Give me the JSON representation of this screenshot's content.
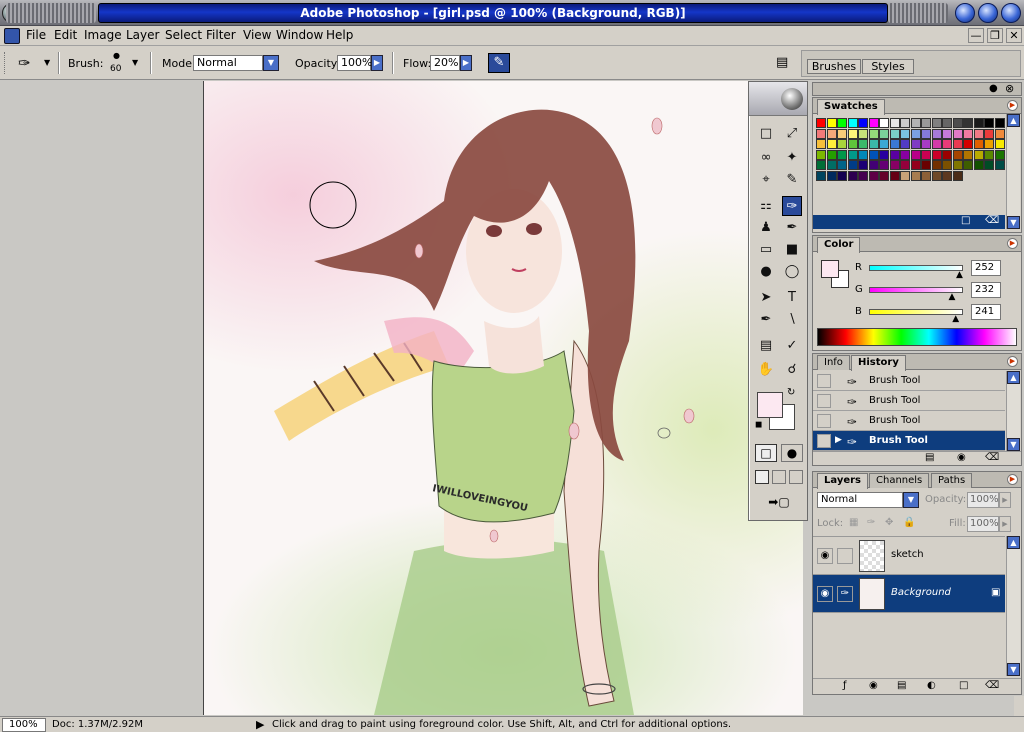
{
  "window": {
    "title": "Adobe Photoshop - [girl.psd @ 100% (Background, RGB)]"
  },
  "menu": [
    "File",
    "Edit",
    "Image",
    "Layer",
    "Select",
    "Filter",
    "View",
    "Window",
    "Help"
  ],
  "options": {
    "brush_label": "Brush:",
    "brush_size": "60",
    "mode_label": "Mode:",
    "mode_value": "Normal",
    "opacity_label": "Opacity:",
    "opacity_value": "100%",
    "flow_label": "Flow:",
    "flow_value": "20%"
  },
  "palette_well": {
    "tabs": [
      "Brushes",
      "Styles"
    ]
  },
  "canvas": {
    "shirt_text": "IWILLOVEINGYOU"
  },
  "swatches_panel": {
    "tab": "Swatches",
    "colors": [
      "#ff0000",
      "#ffff00",
      "#00ff00",
      "#00ffff",
      "#0000ff",
      "#ff00ff",
      "#ffffff",
      "#e6e6e6",
      "#cccccc",
      "#b3b3b3",
      "#999999",
      "#808080",
      "#666666",
      "#4d4d4d",
      "#333333",
      "#1a1a1a",
      "#000000",
      "#000000",
      "#f27a7a",
      "#f5a87a",
      "#f9cd7a",
      "#fff57a",
      "#c8e37a",
      "#94d97a",
      "#7ad19a",
      "#7ad1c6",
      "#7ac4e3",
      "#7aa0e3",
      "#857ad9",
      "#a67ad9",
      "#c67ad9",
      "#e07ac6",
      "#f07aa0",
      "#f07a86",
      "#ec3b3b",
      "#f08a3b",
      "#f7bf3b",
      "#fff03b",
      "#a8d43b",
      "#5fc43b",
      "#3bb86a",
      "#3bb8a8",
      "#3ba8d4",
      "#3b78d4",
      "#523bc4",
      "#7f3bc4",
      "#a83bc4",
      "#d43ba8",
      "#e83b78",
      "#e83b52",
      "#d40000",
      "#e06000",
      "#eca000",
      "#f7e800",
      "#7cb800",
      "#24a000",
      "#00984a",
      "#009a8a",
      "#0088b8",
      "#0052b8",
      "#2800a0",
      "#5a00a0",
      "#8800a0",
      "#b80088",
      "#cc0052",
      "#cc0028",
      "#9a0000",
      "#a64400",
      "#b07400",
      "#b8aa00",
      "#5a8800",
      "#1a7400",
      "#006e36",
      "#006e64",
      "#006488",
      "#003c88",
      "#1c0074",
      "#420074",
      "#640074",
      "#880064",
      "#94003c",
      "#94001c",
      "#6a0000",
      "#733000",
      "#7a5000",
      "#807600",
      "#3e5e00",
      "#125000",
      "#004c26",
      "#004c46",
      "#00445e",
      "#002a5e",
      "#140050",
      "#2e0050",
      "#460050",
      "#5e0046",
      "#66002a",
      "#660014",
      "#c8a278",
      "#a87c50",
      "#8c6038",
      "#6e4828",
      "#5c3820",
      "#4a2c18"
    ],
    "footer_color": "#0e3d7e"
  },
  "color_panel": {
    "tab": "Color",
    "fg_color": "#fce8f1",
    "channels": [
      {
        "label": "R",
        "value": "252",
        "fraction": 0.99,
        "color": "#00ffff"
      },
      {
        "label": "G",
        "value": "232",
        "fraction": 0.91,
        "color": "#ff00ff"
      },
      {
        "label": "B",
        "value": "241",
        "fraction": 0.95,
        "color": "#ffff00"
      }
    ]
  },
  "history_panel": {
    "tabs": [
      "Info",
      "History"
    ],
    "items": [
      "Brush Tool",
      "Brush Tool",
      "Brush Tool",
      "Brush Tool"
    ],
    "active_index": 3
  },
  "layers_panel": {
    "tabs": [
      "Layers",
      "Channels",
      "Paths"
    ],
    "blend_mode": "Normal",
    "opacity_label": "Opacity:",
    "opacity_value": "100%",
    "lock_label": "Lock:",
    "fill_label": "Fill:",
    "fill_value": "100%",
    "layers": [
      {
        "name": "sketch",
        "active": false
      },
      {
        "name": "Background",
        "active": true
      }
    ]
  },
  "toolbox": {
    "tools": [
      "marquee-icon",
      "move-icon",
      "lasso-icon",
      "magic-wand-icon",
      "crop-icon",
      "slice-icon",
      "healing-brush-icon",
      "brush-icon",
      "clone-stamp-icon",
      "history-brush-icon",
      "eraser-icon",
      "gradient-icon",
      "blur-icon",
      "dodge-icon",
      "path-select-icon",
      "type-icon",
      "pen-icon",
      "line-icon",
      "notes-icon",
      "eyedropper-icon",
      "hand-icon",
      "zoom-icon"
    ],
    "active": "brush-icon",
    "fg_color": "#fce8f1",
    "bg_color": "#ffffff"
  },
  "status": {
    "zoom": "100%",
    "doc": "Doc: 1.37M/2.92M",
    "hint": "Click and drag to paint using foreground color.  Use Shift, Alt, and Ctrl for additional options."
  }
}
